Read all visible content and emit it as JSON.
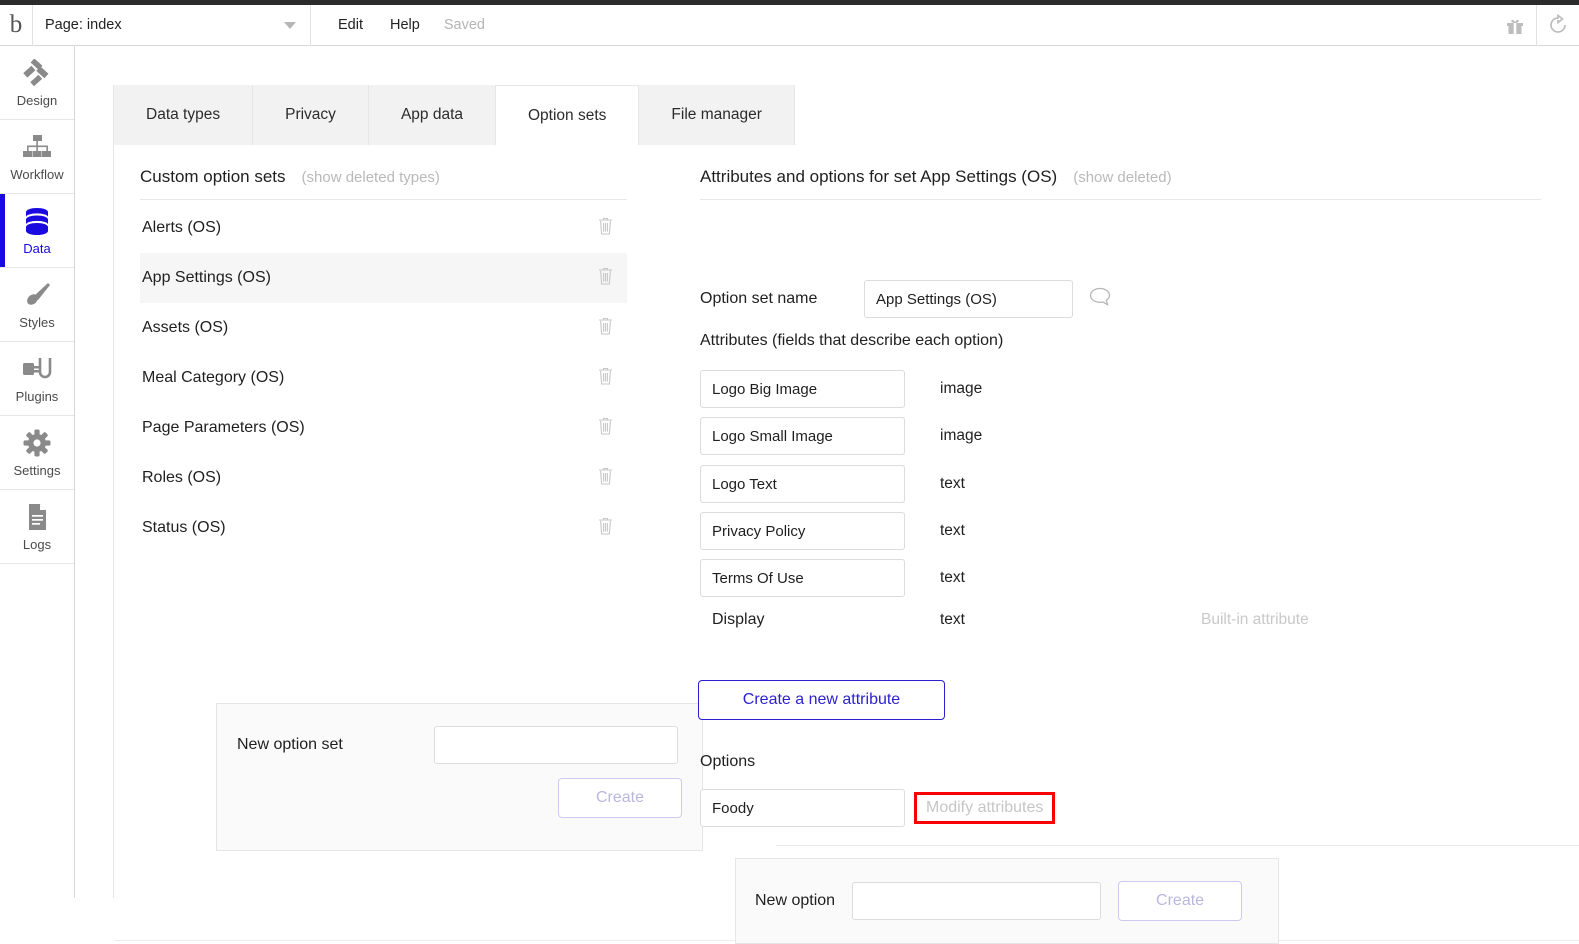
{
  "header": {
    "logo": "bubble-logo",
    "page_selector_label": "Page: index",
    "edit_label": "Edit",
    "help_label": "Help",
    "status_label": "Saved",
    "gift_icon": "gift-icon",
    "undo_icon": "undo-icon"
  },
  "rail": {
    "items": [
      {
        "label": "Design",
        "icon": "design-icon",
        "active": false
      },
      {
        "label": "Workflow",
        "icon": "workflow-icon",
        "active": false
      },
      {
        "label": "Data",
        "icon": "database-icon",
        "active": true
      },
      {
        "label": "Styles",
        "icon": "brush-icon",
        "active": false
      },
      {
        "label": "Plugins",
        "icon": "plug-icon",
        "active": false
      },
      {
        "label": "Settings",
        "icon": "gear-icon",
        "active": false
      },
      {
        "label": "Logs",
        "icon": "document-icon",
        "active": false
      }
    ]
  },
  "tabs": [
    {
      "label": "Data types",
      "active": false
    },
    {
      "label": "Privacy",
      "active": false
    },
    {
      "label": "App data",
      "active": false
    },
    {
      "label": "Option sets",
      "active": true
    },
    {
      "label": "File manager",
      "active": false
    }
  ],
  "left_panel": {
    "title": "Custom option sets",
    "show_deleted_link": "(show deleted types)",
    "option_sets": [
      {
        "name": "Alerts (OS)",
        "selected": false
      },
      {
        "name": "App Settings (OS)",
        "selected": true
      },
      {
        "name": "Assets (OS)",
        "selected": false
      },
      {
        "name": "Meal Category (OS)",
        "selected": false
      },
      {
        "name": "Page Parameters (OS)",
        "selected": false
      },
      {
        "name": "Roles (OS)",
        "selected": false
      },
      {
        "name": "Status (OS)",
        "selected": false
      }
    ],
    "new_option_set": {
      "label": "New option set",
      "value": "",
      "placeholder": "",
      "create_label": "Create"
    }
  },
  "right_panel": {
    "title": "Attributes and options for set App Settings (OS)",
    "show_deleted_link": "(show deleted)",
    "option_set_name_label": "Option set name",
    "option_set_name_value": "App Settings (OS)",
    "comment_icon": "speech-bubble-icon",
    "attributes_heading": "Attributes (fields that describe each option)",
    "attributes": [
      {
        "name": "Logo Big Image",
        "type": "image",
        "note": "",
        "editable": true
      },
      {
        "name": "Logo Small Image",
        "type": "image",
        "note": "",
        "editable": true
      },
      {
        "name": "Logo Text",
        "type": "text",
        "note": "",
        "editable": true
      },
      {
        "name": "Privacy Policy",
        "type": "text",
        "note": "",
        "editable": true
      },
      {
        "name": "Terms Of Use",
        "type": "text",
        "note": "",
        "editable": true
      },
      {
        "name": "Display",
        "type": "text",
        "note": "Built-in attribute",
        "editable": false
      }
    ],
    "create_attribute_label": "Create a new attribute",
    "options_heading": "Options",
    "options": [
      {
        "name": "Foody",
        "modify_label": "Modify attributes",
        "highlighted": true
      }
    ],
    "new_option": {
      "label": "New option",
      "value": "",
      "placeholder": "",
      "create_label": "Create"
    }
  },
  "colors": {
    "accent_blue": "#1a0ae0",
    "button_blue": "#2b1fcf",
    "highlight_red": "#fb0000",
    "muted_gray": "#b9b9b9",
    "selected_row": "#f6f6f6",
    "tab_inactive": "#f2f2f2"
  }
}
